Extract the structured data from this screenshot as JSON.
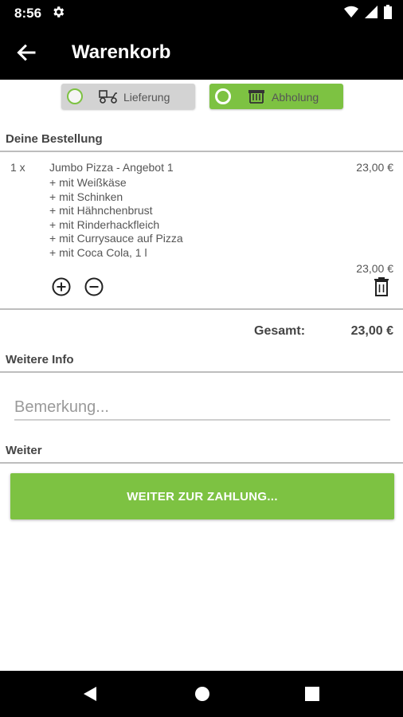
{
  "status": {
    "time": "8:56"
  },
  "appbar": {
    "title": "Warenkorb"
  },
  "delivery": {
    "options": [
      {
        "label": "Lieferung",
        "selected": false
      },
      {
        "label": "Abholung",
        "selected": true
      }
    ],
    "accent": "#7dc242"
  },
  "order": {
    "heading": "Deine Bestellung",
    "items": [
      {
        "qty": "1 x",
        "name": "Jumbo Pizza - Angebot 1",
        "price": "23,00 €",
        "options": [
          "+ mit Weißkäse",
          "+ mit Schinken",
          "+ mit Hähnchenbrust",
          "+ mit Rinderhackfleich",
          "+ mit Currysauce auf Pizza",
          "+ mit Coca Cola, 1 l"
        ],
        "subtotal": "23,00 €"
      }
    ],
    "total_label": "Gesamt:",
    "total_value": "23,00 €"
  },
  "info": {
    "heading": "Weitere Info",
    "remark_placeholder": "Bemerkung..."
  },
  "next": {
    "heading": "Weiter",
    "button_label": "WEITER ZUR ZAHLUNG..."
  }
}
